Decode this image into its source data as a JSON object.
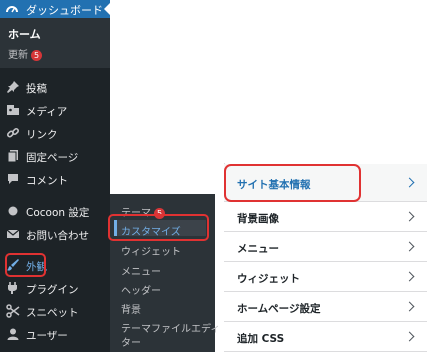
{
  "sidebar": {
    "dashboard": {
      "label": "ダッシュボード",
      "icon": "dashboard-icon"
    },
    "home_label": "ホーム",
    "updates": {
      "label": "更新",
      "count": "5"
    },
    "items": [
      {
        "label": "投稿",
        "icon": "pin-icon"
      },
      {
        "label": "メディア",
        "icon": "media-icon"
      },
      {
        "label": "リンク",
        "icon": "link-icon"
      },
      {
        "label": "固定ページ",
        "icon": "page-icon"
      },
      {
        "label": "コメント",
        "icon": "comment-icon"
      },
      {
        "label": "Cocoon 設定",
        "icon": "cocoon-icon"
      },
      {
        "label": "お問い合わせ",
        "icon": "mail-icon"
      },
      {
        "label": "外観",
        "icon": "brush-icon"
      },
      {
        "label": "プラグイン",
        "icon": "plugin-icon"
      },
      {
        "label": "スニペット",
        "icon": "scissors-icon"
      },
      {
        "label": "ユーザー",
        "icon": "user-icon"
      }
    ]
  },
  "appearance_submenu": {
    "items": [
      {
        "label": "テーマ",
        "badge": "5"
      },
      {
        "label": "カスタマイズ"
      },
      {
        "label": "ウィジェット"
      },
      {
        "label": "メニュー"
      },
      {
        "label": "ヘッダー"
      },
      {
        "label": "背景"
      },
      {
        "label": "テーマファイルエディ"
      },
      {
        "label": "ター"
      }
    ]
  },
  "customizer_panel": {
    "items": [
      {
        "label": "サイト基本情報"
      },
      {
        "label": "背景画像"
      },
      {
        "label": "メニュー"
      },
      {
        "label": "ウィジェット"
      },
      {
        "label": "ホームページ設定"
      },
      {
        "label": "追加 CSS"
      }
    ]
  },
  "colors": {
    "accent": "#2271b1",
    "highlight_box": "#e03232",
    "sidebar_bg": "#1d2327"
  }
}
